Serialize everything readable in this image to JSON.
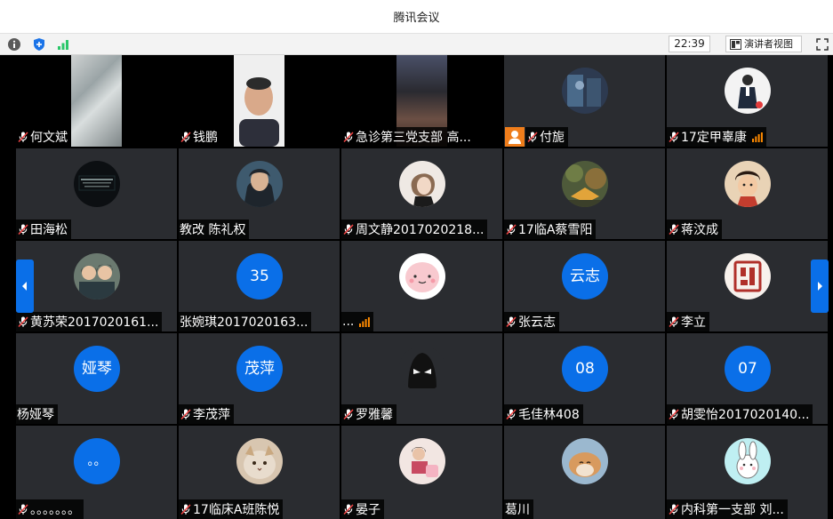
{
  "window": {
    "title": "腾讯会议"
  },
  "toolbar": {
    "time": "22:39",
    "speaker_view_label": "演讲者视图",
    "info_icon": "info-icon",
    "shield_icon": "shield-icon",
    "signal_icon": "signal-bars-icon",
    "fullscreen_icon": "fullscreen-icon"
  },
  "participants": [
    {
      "name": "何文斌",
      "avatar": "video"
    },
    {
      "name": "钱鹏",
      "avatar": "video"
    },
    {
      "name": "急诊第三党支部 高...",
      "avatar": "video"
    },
    {
      "name": "付旎",
      "avatar": "photo"
    },
    {
      "name": "17定甲辜康",
      "avatar": "photo"
    },
    {
      "name": "田海松",
      "avatar": "photo"
    },
    {
      "name": "教改 陈礼权",
      "avatar": "photo"
    },
    {
      "name": "周文静2017020218...",
      "avatar": "photo"
    },
    {
      "name": "17临A蔡雪阳",
      "avatar": "photo"
    },
    {
      "name": "蒋汶成",
      "avatar": "photo"
    },
    {
      "name": "黄苏荣2017020161...",
      "avatar": "photo"
    },
    {
      "name": "张婉琪2017020163...",
      "avatar": "text",
      "avatar_text": "35"
    },
    {
      "name": "...",
      "avatar": "photo"
    },
    {
      "name": "张云志",
      "avatar": "text",
      "avatar_text": "云志"
    },
    {
      "name": "李立",
      "avatar": "photo"
    },
    {
      "name": "杨娅琴",
      "avatar": "text",
      "avatar_text": "娅琴"
    },
    {
      "name": "李茂萍",
      "avatar": "text",
      "avatar_text": "茂萍"
    },
    {
      "name": "罗雅馨",
      "avatar": "photo"
    },
    {
      "name": "毛佳林408",
      "avatar": "text",
      "avatar_text": "08"
    },
    {
      "name": "胡雯怡2017020140...",
      "avatar": "text",
      "avatar_text": "07"
    },
    {
      "name": "。。。。。。。",
      "avatar": "text",
      "avatar_text": "。。"
    },
    {
      "name": "17临床A班陈悦",
      "avatar": "photo"
    },
    {
      "name": "晏子",
      "avatar": "photo"
    },
    {
      "name": "葛川",
      "avatar": "photo"
    },
    {
      "name": "内科第一支部 刘...",
      "avatar": "photo"
    }
  ],
  "colors": {
    "accent": "#0a6fe8",
    "tile_bg": "#2a2c30",
    "host_badge": "#ef7d1b",
    "signal": "#ff8a00",
    "signal_good": "#2ac769"
  }
}
